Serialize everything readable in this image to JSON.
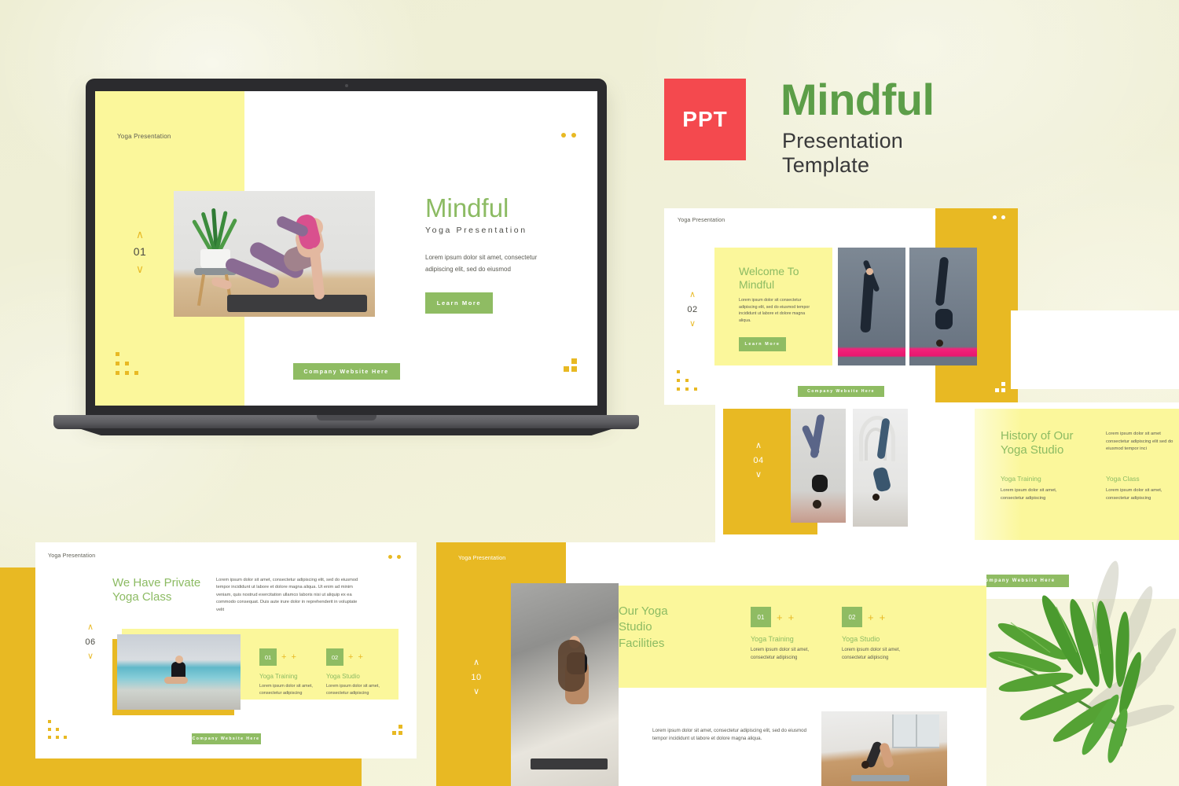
{
  "header": {
    "badge": "PPT",
    "badge_color": "#f4494e",
    "title": "Mindful",
    "subtitle": "Presentation Template",
    "title_color": "#5c9e48"
  },
  "theme": {
    "background": "#eeeed4",
    "green": "#8fbc63",
    "title_green": "#8cbb63",
    "pale_yellow": "#fbf79b",
    "gold": "#e8b923",
    "body_text": "#5a5a52"
  },
  "common": {
    "kicker": "Yoga Presentation",
    "learn_more": "Learn More",
    "website_bar": "Company Website Here",
    "chevron_up": "∧",
    "chevron_down": "∨",
    "plus": "+"
  },
  "slides": [
    {
      "id": "slide-01",
      "number": "01",
      "kicker": "Yoga Presentation",
      "title": "Mindful",
      "subtitle": "Yoga Presentation",
      "body": "Lorem ipsum dolor sit amet, consectetur adipiscing elit, sed do eiusmod",
      "cta": "Learn More",
      "website_bar": "Company Website Here",
      "photo_alt": "woman-in-purple-leggings-yoga-pose-with-plant"
    },
    {
      "id": "slide-02",
      "number": "02",
      "kicker": "Yoga Presentation",
      "title": "Welcome To Mindful",
      "body": "Lorem ipsum dolor sit consectetur adipiscing elit, sed do eiusmod tempor incididunt ut labore et dolore magna aliqua.",
      "cta": "Learn More",
      "website_bar": "Company Website Here",
      "photo_alt_1": "woman-standing-split-pose-grey-backdrop",
      "photo_alt_2": "woman-headstand-pose-grey-backdrop"
    },
    {
      "id": "slide-04",
      "number": "04",
      "title": "History of Our Yoga Studio",
      "body": "Lorem ipsum dolor sit amet consectetur adipiscing elit sed do eiusmod tempor inci",
      "website_bar": "Company Website Here",
      "features": [
        {
          "heading": "Yoga Training",
          "text": "Lorem ipsum dolor sit amet, consectetur adipiscing"
        },
        {
          "heading": "Yoga Class",
          "text": "Lorem ipsum dolor sit amet, consectetur adipiscing"
        }
      ],
      "photo_alt_1": "woman-supported-headstand-pose",
      "photo_alt_2": "woman-backbend-pose-white-arches-corridor"
    },
    {
      "id": "slide-06",
      "number": "06",
      "kicker": "Yoga Presentation",
      "title": "We Have Private Yoga Class",
      "body": "Lorem ipsum dolor sit amet, consectetur adipiscing elit, sed do eiusmod tempor incididunt ut labore et dolore magna aliqua. Ut enim ad minim veniam, quis nostrud exercitation ullamco laboris nisi ut aliquip ex ea commodo consequat. Duis aute irure dolor in reprehenderit in voluptate velit",
      "website_bar": "Company Website Here",
      "cards": [
        {
          "num": "01",
          "heading": "Yoga Training",
          "text": "Lorem ipsum dolor sit amet, consectetur adipiscing"
        },
        {
          "num": "02",
          "heading": "Yoga Studio",
          "text": "Lorem ipsum dolor sit amet, consectetur adipiscing"
        }
      ],
      "photo_alt": "woman-lotus-pose-by-swimming-pool"
    },
    {
      "id": "slide-10",
      "number": "10",
      "kicker": "Yoga Presentation",
      "title": "Our Yoga Studio Facilities",
      "body": "Lorem ipsum dolor sit amet, consectetur adipiscing elit, sed do eiusmod tempor incididunt ut labore et dolore magna aliqua.",
      "cards": [
        {
          "num": "01",
          "heading": "Yoga Training",
          "text": "Lorem ipsum dolor sit amet, consectetur adipiscing"
        },
        {
          "num": "02",
          "heading": "Yoga Studio",
          "text": "Lorem ipsum dolor sit amet, consectetur adipiscing"
        }
      ],
      "photo_alt_1": "woman-kneeling-on-mat-in-sunlit-studio",
      "photo_alt_2": "woman-downward-dog-pose-in-loft-studio"
    }
  ],
  "decor": {
    "leaf_alt": "palm-leaf-with-shadow"
  }
}
